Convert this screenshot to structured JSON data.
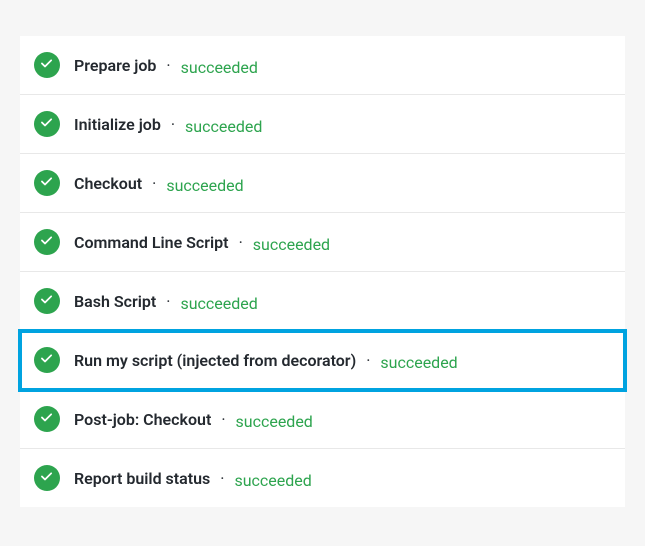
{
  "status_label": "succeeded",
  "separator": "·",
  "steps": [
    {
      "name": "Prepare job",
      "status": "succeeded",
      "highlighted": false
    },
    {
      "name": "Initialize job",
      "status": "succeeded",
      "highlighted": false
    },
    {
      "name": "Checkout",
      "status": "succeeded",
      "highlighted": false
    },
    {
      "name": "Command Line Script",
      "status": "succeeded",
      "highlighted": false
    },
    {
      "name": "Bash Script",
      "status": "succeeded",
      "highlighted": false
    },
    {
      "name": "Run my script (injected from decorator)",
      "status": "succeeded",
      "highlighted": true
    },
    {
      "name": "Post-job: Checkout",
      "status": "succeeded",
      "highlighted": false
    },
    {
      "name": "Report build status",
      "status": "succeeded",
      "highlighted": false
    }
  ]
}
